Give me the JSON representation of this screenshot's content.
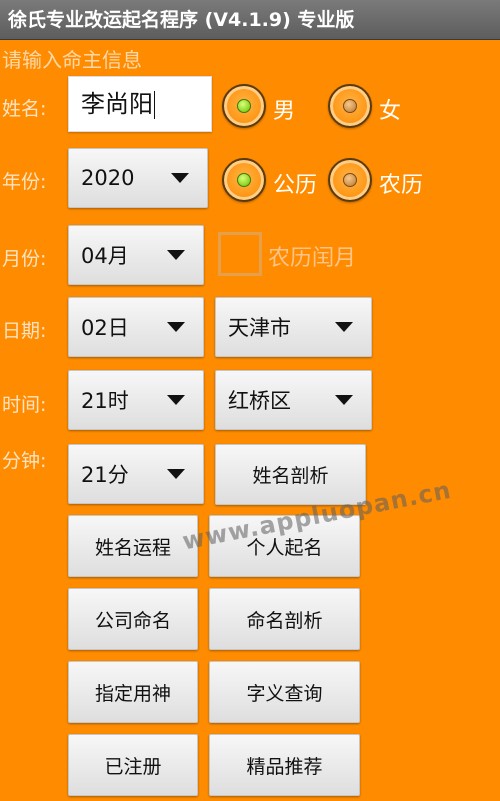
{
  "app_title": "徐氏专业改运起名程序 (V4.1.9)  专业版",
  "section_title": "请输入命主信息",
  "labels": {
    "name": "姓名:",
    "year": "年份:",
    "month": "月份:",
    "day": "日期:",
    "hour": "时间:",
    "minute": "分钟:"
  },
  "name_input": {
    "value": "李尚阳"
  },
  "gender": {
    "male": "男",
    "female": "女",
    "selected": "male"
  },
  "calendar": {
    "solar": "公历",
    "lunar": "农历",
    "selected": "solar"
  },
  "leap_month": {
    "label": "农历闰月",
    "checked": false
  },
  "spinners": {
    "year": "2020",
    "month": "04月",
    "day": "02日",
    "hour": "21时",
    "minute": "21分",
    "province": "天津市",
    "district": "红桥区"
  },
  "buttons": {
    "name_analysis": "姓名剖析",
    "name_fortune": "姓名运程",
    "personal_naming": "个人起名",
    "company_naming": "公司命名",
    "naming_analysis": "命名剖析",
    "designated_god": "指定用神",
    "char_meaning": "字义查询",
    "registered": "已注册",
    "featured": "精品推荐"
  },
  "watermark": "www.appluopan.cn",
  "colors": {
    "background": "#FF8C00",
    "titlebar": "#666666"
  }
}
